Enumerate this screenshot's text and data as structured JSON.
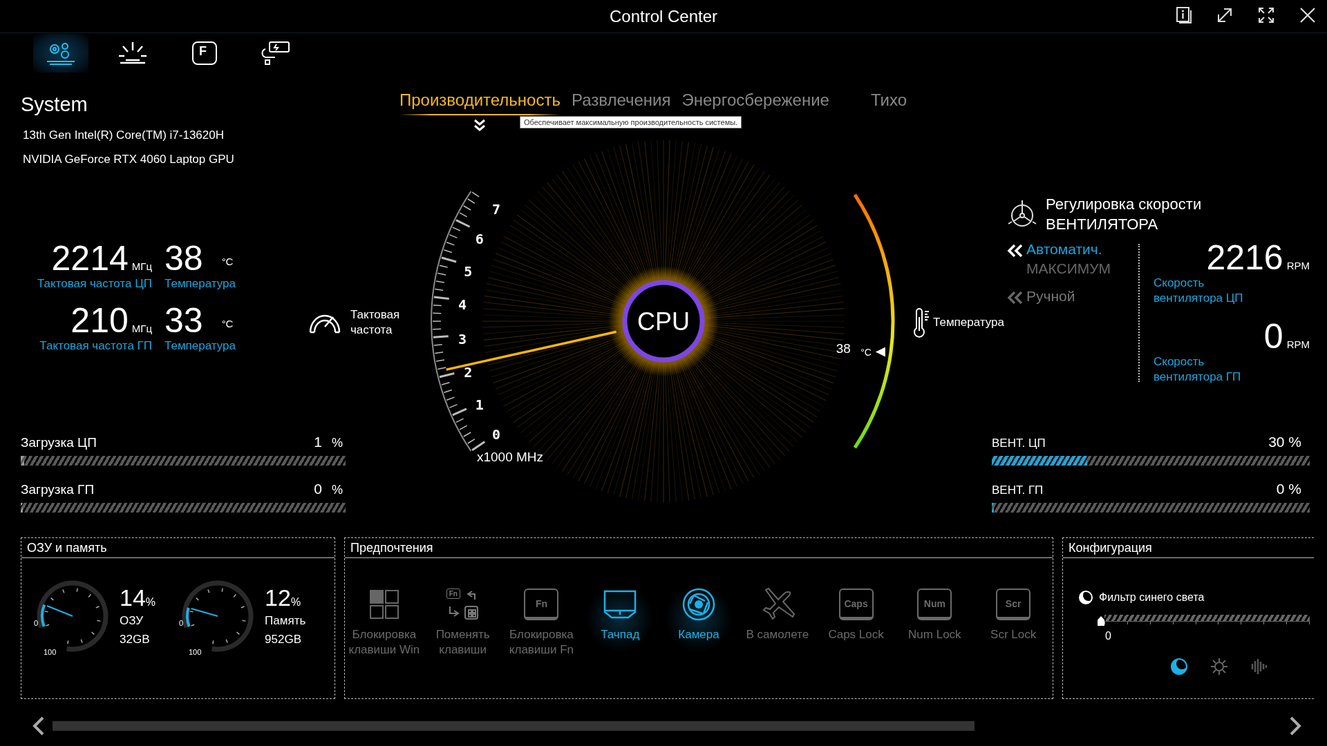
{
  "window": {
    "title": "Control Center"
  },
  "nav_tabs": [
    {
      "kind": "system",
      "selected": true
    },
    {
      "kind": "lighting",
      "selected": false
    },
    {
      "kind": "keyboard",
      "key": "F",
      "selected": false
    },
    {
      "kind": "battery",
      "selected": false
    }
  ],
  "system": {
    "title": "System",
    "cpu": "13th Gen Intel(R) Core(TM) i7-13620H",
    "gpu": "NVIDIA GeForce RTX 4060 Laptop GPU"
  },
  "stats": [
    {
      "value": "2214",
      "unit": "МГц",
      "label": "Тактовая частота ЦП",
      "temp": "38",
      "temp_unit": "°C",
      "temp_label": "Температура"
    },
    {
      "value": "210",
      "unit": "МГц",
      "label": "Тактовая частота ГП",
      "temp": "33",
      "temp_unit": "°C",
      "temp_label": "Температура"
    }
  ],
  "loads": [
    {
      "label": "Загрузка ЦП",
      "value": "1",
      "unit": "%",
      "level": 0.01
    },
    {
      "label": "Загрузка ГП",
      "value": "0",
      "unit": "%",
      "level": 0
    }
  ],
  "modes": [
    {
      "label": "Производительность",
      "selected": true
    },
    {
      "label": "Развлечения",
      "selected": false
    },
    {
      "label": "Энергосбережение",
      "selected": false
    },
    {
      "label": "Тихо",
      "selected": false
    }
  ],
  "tooltip": "Обеспечивает максимальную производительность системы.",
  "clock_gauge": {
    "label": "Тактовая частота",
    "ticks": [
      "7",
      "6",
      "5",
      "4",
      "3",
      "2",
      "1",
      "0"
    ],
    "unit": "x1000 MHz",
    "level": 0.315
  },
  "cpu_label": "CPU",
  "temp_gauge": {
    "label": "Температура",
    "value": "38",
    "unit": "°C",
    "level": 0.38
  },
  "fan": {
    "title": "Регулировка скорости ВЕНТИЛЯТОРА",
    "modes": [
      {
        "label": "Автоматич.",
        "sub": "МАКСИМУМ",
        "selected": true
      },
      {
        "label": "Ручной",
        "selected": false
      }
    ],
    "speeds": [
      {
        "value": "2216",
        "unit": "RPM",
        "label": "Скорость вентилятора ЦП"
      },
      {
        "value": "0",
        "unit": "RPM",
        "label": "Скорость вентилятора ГП"
      }
    ]
  },
  "fan_bars": [
    {
      "label": "ВЕНТ. ЦП",
      "value": "30 %",
      "level": 0.3
    },
    {
      "label": "ВЕНТ. ГП",
      "value": "0 %",
      "level": 0
    }
  ],
  "ram": {
    "title": "ОЗУ и память",
    "gauges": [
      {
        "value": "14",
        "unit": "%",
        "label": "ОЗУ",
        "size": "32GB",
        "min": "0",
        "max": "100",
        "level": 0.14
      },
      {
        "value": "12",
        "unit": "%",
        "label": "Память",
        "size": "952GB",
        "min": "0",
        "max": "100",
        "level": 0.12
      }
    ]
  },
  "prefs": {
    "title": "Предпочтения",
    "items": [
      {
        "kind": "win_lock",
        "label": "Блокировка клавиши Win",
        "on": false
      },
      {
        "kind": "swap_keys",
        "key": "Fn",
        "label": "Поменять клавиши",
        "on": false
      },
      {
        "kind": "keycap",
        "key": "Fn",
        "label": "Блокировка клавиши Fn",
        "on": false
      },
      {
        "kind": "touchpad",
        "label": "Тачпад",
        "on": true
      },
      {
        "kind": "camera",
        "label": "Камера",
        "on": true
      },
      {
        "kind": "airplane",
        "label": "В самолете",
        "on": false
      },
      {
        "kind": "keycap",
        "key": "Caps",
        "label": "Caps Lock",
        "on": false
      },
      {
        "kind": "keycap",
        "key": "Num",
        "label": "Num Lock",
        "on": false
      },
      {
        "kind": "keycap",
        "key": "Scr",
        "label": "Scr Lock",
        "on": false
      }
    ]
  },
  "config": {
    "title": "Конфигурация",
    "filter_label": "Фильтр синего света",
    "level": 0,
    "reading": "0",
    "modes": [
      {
        "kind": "blue_light",
        "selected": true
      },
      {
        "kind": "brightness",
        "selected": false
      },
      {
        "kind": "audio",
        "selected": false
      }
    ]
  }
}
